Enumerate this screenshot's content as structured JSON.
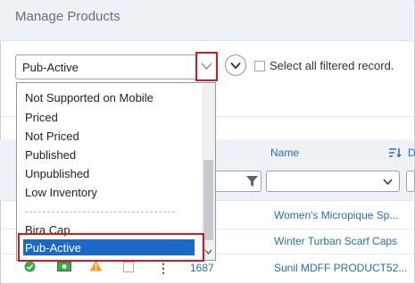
{
  "header": {
    "title": "Manage Products"
  },
  "filter": {
    "selected_value": "Pub-Active",
    "select_all_label": "Select all filtered record."
  },
  "dropdown": {
    "options": [
      "Not Supported on Mobile",
      "Priced",
      "Not Priced",
      "Published",
      "Unpublished",
      "Low Inventory",
      "Bira Cap",
      "Pub-Active"
    ],
    "selected": "Pub-Active"
  },
  "grid": {
    "columns": {
      "name": "Name",
      "partial": "D"
    },
    "rows": [
      {
        "id": "",
        "name": "Women's Micropique Sp..."
      },
      {
        "id": "",
        "name": "Winter Turban Scarf Caps"
      },
      {
        "id": "1687",
        "name": "Sunil MDFF PRODUCT52..."
      }
    ]
  },
  "icons": {
    "dropdown_chevron": "chevron-down-icon",
    "expand": "chevron-down-circle-icon",
    "filter": "funnel-icon",
    "sort": "sort-descending-icon",
    "status_ok": "check-circle-icon",
    "money": "money-icon",
    "warning": "warning-icon",
    "more": "kebab-menu-icon"
  },
  "colors": {
    "highlight": "#e0151b",
    "selection": "#1a69c6",
    "link": "#2a6db3"
  }
}
